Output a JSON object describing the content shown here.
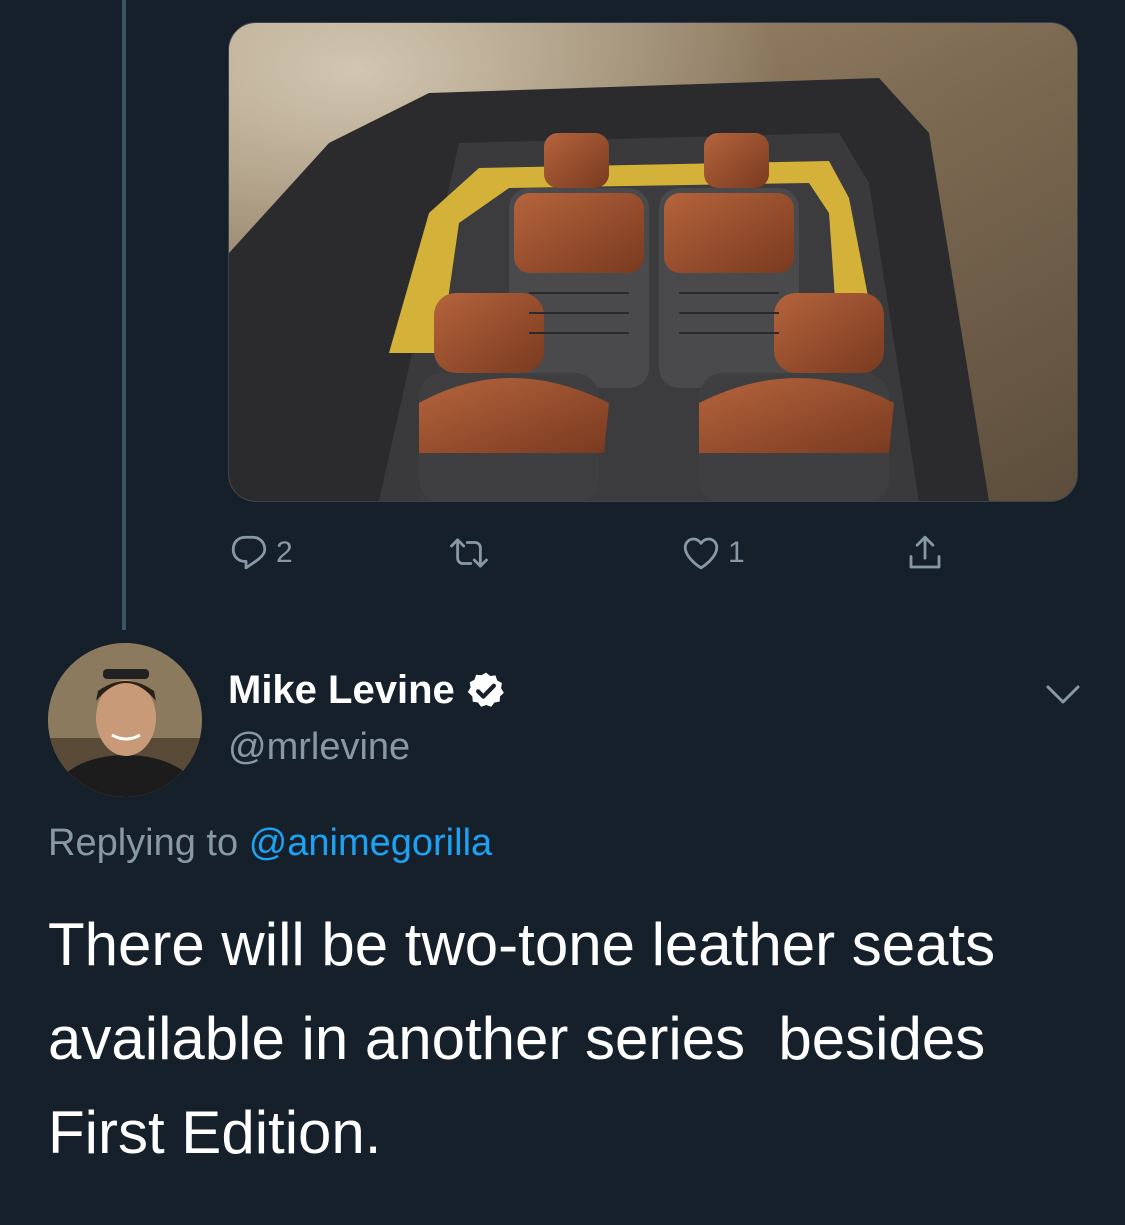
{
  "parent_tweet": {
    "media": {
      "alt_name": "vehicle-interior-photo"
    },
    "actions": {
      "reply_count": "2",
      "retweet_count": "",
      "like_count": "1"
    }
  },
  "tweet": {
    "author_name": "Mike Levine",
    "author_handle": "@mrlevine",
    "replying_prefix": "Replying to",
    "replying_to": "@animegorilla",
    "text": "There will be two-tone leather seats available in another series  besides First Edition."
  },
  "icons": {
    "reply": "reply-icon",
    "retweet": "retweet-icon",
    "like": "heart-icon",
    "share": "share-icon",
    "verified": "verified-badge-icon",
    "more": "chevron-down-icon"
  },
  "colors": {
    "background": "#15202b",
    "secondary_text": "#8899a6",
    "link": "#1da1f2",
    "thread_line": "#3d5466"
  }
}
